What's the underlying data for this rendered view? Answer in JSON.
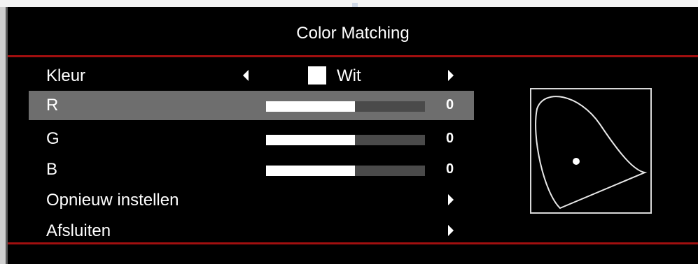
{
  "menu": {
    "title": "Color Matching",
    "kleur": {
      "label": "Kleur",
      "value": "Wit",
      "swatch_color": "#ffffff"
    },
    "channels": [
      {
        "label": "R",
        "value": "0",
        "level": 0.56,
        "highlighted": true
      },
      {
        "label": "G",
        "value": "0",
        "level": 0.56,
        "highlighted": false
      },
      {
        "label": "B",
        "value": "0",
        "level": 0.56,
        "highlighted": false
      }
    ],
    "reset_label": "Opnieuw instellen",
    "exit_label": "Afsluiten"
  },
  "colors": {
    "background": "#000000",
    "accent_line": "#a10f0f",
    "highlight_row": "#6e6e6e",
    "slider_track": "#4a4a4a",
    "slider_fill": "#ffffff"
  }
}
